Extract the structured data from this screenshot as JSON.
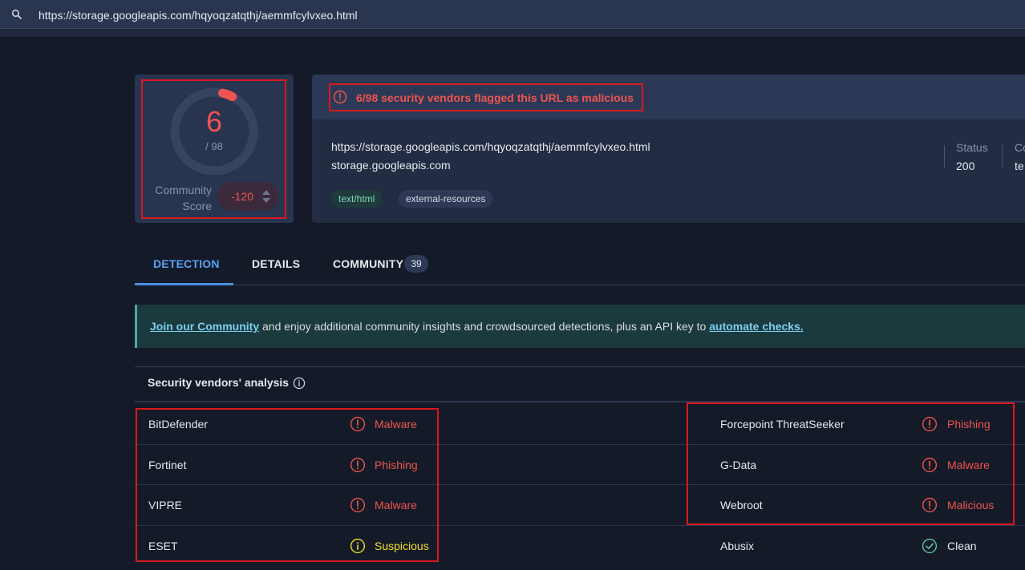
{
  "search": {
    "value": "https://storage.googleapis.com/hqyoqzatqthj/aemmfcylvxeo.html"
  },
  "score": {
    "detections": "6",
    "total": "/ 98",
    "detection_fraction": 0.0612,
    "community_label_line1": "Community",
    "community_label_line2": "Score",
    "community_value": "-120"
  },
  "alert": {
    "text": "6/98 security vendors flagged this URL as malicious"
  },
  "info": {
    "url": "https://storage.googleapis.com/hqyoqzatqthj/aemmfcylvxeo.html",
    "domain": "storage.googleapis.com",
    "tags": [
      "text/html",
      "external-resources"
    ],
    "status_label": "Status",
    "status_value": "200",
    "col3_label": "Co",
    "col3_value": "te"
  },
  "tabs": [
    {
      "label": "DETECTION"
    },
    {
      "label": "DETAILS"
    },
    {
      "label": "COMMUNITY",
      "badge": "39"
    }
  ],
  "banner": {
    "link1": "Join our Community",
    "middle": " and enjoy additional community insights and crowdsourced detections, plus an API key to ",
    "link2": "automate checks."
  },
  "vendors": {
    "title": "Security vendors' analysis",
    "rows": [
      {
        "left": {
          "name": "BitDefender",
          "result": "Malware",
          "level": "malicious"
        },
        "right": {
          "name": "Forcepoint ThreatSeeker",
          "result": "Phishing",
          "level": "malicious"
        }
      },
      {
        "left": {
          "name": "Fortinet",
          "result": "Phishing",
          "level": "malicious"
        },
        "right": {
          "name": "G-Data",
          "result": "Malware",
          "level": "malicious"
        }
      },
      {
        "left": {
          "name": "VIPRE",
          "result": "Malware",
          "level": "malicious"
        },
        "right": {
          "name": "Webroot",
          "result": "Malicious",
          "level": "malicious"
        }
      },
      {
        "left": {
          "name": "ESET",
          "result": "Suspicious",
          "level": "suspicious"
        },
        "right": {
          "name": "Abusix",
          "result": "Clean",
          "level": "clean"
        }
      }
    ]
  },
  "colors": {
    "malicious": "#ee5450",
    "suspicious": "#f0e02a",
    "clean": "#e6e9ef",
    "clean_icon": "#5bc4a4",
    "accent": "#5aa2f5"
  },
  "icons": {
    "search": "search-icon",
    "alert": "alert-circle-icon",
    "info": "info-circle-icon",
    "malicious": "alert-circle-icon",
    "suspicious": "info-circle-icon",
    "clean": "check-circle-icon"
  }
}
